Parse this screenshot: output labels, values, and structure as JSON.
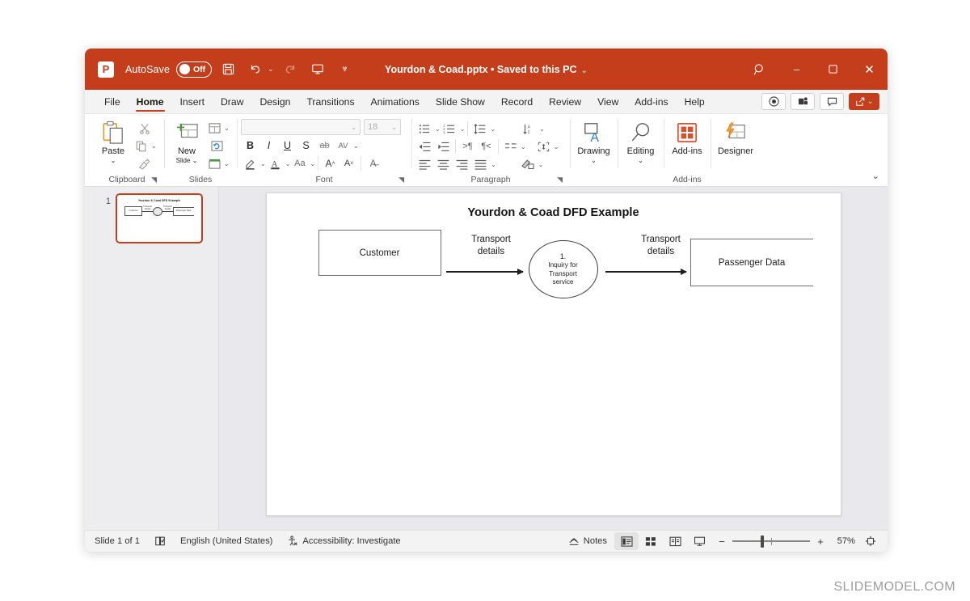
{
  "titlebar": {
    "app_logo": "powerpoint-logo",
    "autosave_label": "AutoSave",
    "autosave_state": "Off",
    "save_icon": "save-icon",
    "undo_icon": "undo-icon",
    "redo_icon": "redo-icon",
    "present_icon": "start-presentation-icon",
    "customize_icon": "customize-quick-access-icon",
    "document_title": "Yourdon & Coad.pptx • Saved to this PC",
    "title_caret": "⌄",
    "search_icon": "search-icon",
    "minimize": "–",
    "maximize": "▫",
    "close": "✕",
    "accent_color": "#c43e1c"
  },
  "ribbon_tabs": {
    "items": [
      {
        "label": "File",
        "active": false
      },
      {
        "label": "Home",
        "active": true
      },
      {
        "label": "Insert",
        "active": false
      },
      {
        "label": "Draw",
        "active": false
      },
      {
        "label": "Design",
        "active": false
      },
      {
        "label": "Transitions",
        "active": false
      },
      {
        "label": "Animations",
        "active": false
      },
      {
        "label": "Slide Show",
        "active": false
      },
      {
        "label": "Record",
        "active": false
      },
      {
        "label": "Review",
        "active": false
      },
      {
        "label": "View",
        "active": false
      },
      {
        "label": "Add-ins",
        "active": false
      },
      {
        "label": "Help",
        "active": false
      }
    ],
    "right_buttons": [
      {
        "name": "record-button",
        "icon": "record-circle-icon"
      },
      {
        "name": "teams-button",
        "icon": "teams-icon"
      },
      {
        "name": "comments-button",
        "icon": "comment-icon"
      }
    ],
    "share_label": "Share",
    "share_caret": "⌄"
  },
  "ribbon": {
    "clipboard": {
      "group_label": "Clipboard",
      "paste_label": "Paste",
      "paste_caret": "⌄",
      "cut_icon": "scissors-icon",
      "copy_icon": "copy-icon",
      "format_painter_icon": "format-painter-icon",
      "dialog_launcher": "⌐"
    },
    "slides": {
      "group_label": "Slides",
      "new_slide_label": "New",
      "new_slide_label2": "Slide",
      "new_slide_caret": "⌄",
      "layout_icon": "layout-icon",
      "reset_icon": "reset-icon",
      "section_icon": "section-icon"
    },
    "font": {
      "group_label": "Font",
      "font_name_value": "",
      "font_size_value": "18",
      "bold": "B",
      "italic": "I",
      "underline": "U",
      "strikethrough": "S",
      "text_shadow": "ab",
      "character_spacing": "AV",
      "text_highlight_icon": "highlight-icon",
      "font_color_icon": "font-color-icon",
      "change_case": "Aa",
      "increase_size": "A",
      "decrease_size": "A",
      "clear_formatting": "A",
      "dialog_launcher": "⌐"
    },
    "paragraph": {
      "group_label": "Paragraph",
      "bullets_icon": "bullets-icon",
      "numbering_icon": "numbering-icon",
      "line_spacing_icon": "line-spacing-icon",
      "text_direction_icon": "text-direction-icon",
      "decrease_indent_icon": "decrease-indent-icon",
      "increase_indent_icon": "increase-indent-icon",
      "ltr_icon": "left-to-right-icon",
      "rtl_icon": "right-to-left-icon",
      "columns_icon": "columns-icon",
      "align_text_icon": "align-text-icon",
      "align_left_icon": "align-left-icon",
      "align_center_icon": "align-center-icon",
      "align_right_icon": "align-right-icon",
      "justify_icon": "justify-icon",
      "smartart_icon": "convert-to-smartart-icon",
      "dialog_launcher": "⌐"
    },
    "drawing": {
      "label": "Drawing",
      "caret": "⌄",
      "icon": "drawing-shapes-icon"
    },
    "editing": {
      "label": "Editing",
      "caret": "⌄",
      "icon": "find-magnifier-icon"
    },
    "addins": {
      "label": "Add-ins",
      "group_label": "Add-ins",
      "icon": "addins-grid-icon"
    },
    "designer": {
      "label": "Designer",
      "icon": "designer-lightning-icon"
    },
    "collapse_caret": "⌄"
  },
  "thumbnails": {
    "slides": [
      {
        "number": "1",
        "selected": true,
        "title": "Yourdon & Coad DFD Example",
        "labels": [
          "Customer",
          "Transport details",
          "1. Inquiry for Transport service",
          "Transport details",
          "Passenger Data"
        ]
      }
    ]
  },
  "slide": {
    "title": "Yourdon & Coad DFD Example",
    "diagram": {
      "external_entity": "Customer",
      "flow1_line1": "Transport",
      "flow1_line2": "details",
      "process_number": "1.",
      "process_line1": "Inquiry for",
      "process_line2": "Transport",
      "process_line3": "service",
      "flow2_line1": "Transport",
      "flow2_line2": "details",
      "data_store": "Passenger Data"
    }
  },
  "statusbar": {
    "slide_count": "Slide 1 of 1",
    "spellcheck_icon": "spellcheck-icon",
    "language": "English (United States)",
    "accessibility_icon": "accessibility-icon",
    "accessibility": "Accessibility: Investigate",
    "notes_label": "Notes",
    "notes_icon": "notes-icon",
    "views": [
      {
        "name": "normal-view-button",
        "icon": "normal-view-icon",
        "active": true
      },
      {
        "name": "slide-sorter-button",
        "icon": "slide-sorter-icon",
        "active": false
      },
      {
        "name": "reading-view-button",
        "icon": "reading-view-icon",
        "active": false
      },
      {
        "name": "slideshow-button",
        "icon": "slideshow-icon",
        "active": false
      }
    ],
    "zoom_out": "−",
    "zoom_in": "+",
    "zoom_level": "57%",
    "fit_icon": "fit-to-window-icon"
  },
  "watermark": {
    "text": "SLIDEMODEL.COM"
  }
}
